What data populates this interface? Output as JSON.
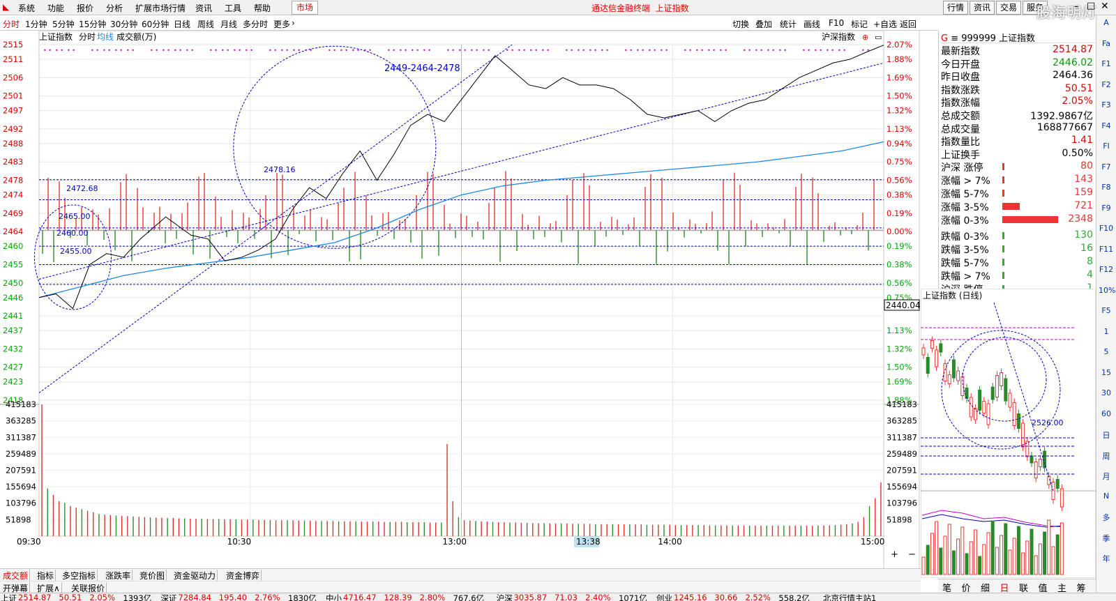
{
  "menu": {
    "items": [
      "系统",
      "功能",
      "报价",
      "分析",
      "扩展市场行情",
      "资讯",
      "工具",
      "帮助"
    ],
    "market_button": "市场",
    "app_title": "通达信金融终端",
    "doc_title": "上证指数",
    "right_buttons": [
      "行情",
      "资讯",
      "交易",
      "服务"
    ],
    "watermark": "股海明灯"
  },
  "periods": {
    "items": [
      "分时",
      "1分钟",
      "5分钟",
      "15分钟",
      "30分钟",
      "60分钟",
      "日线",
      "周线",
      "月线",
      "多分时",
      "更多"
    ],
    "active": "分时",
    "tools": [
      "切换",
      "叠加",
      "统计",
      "画线",
      "F10",
      "标记",
      "+自选",
      "返回"
    ]
  },
  "chart_header": {
    "index_name": "上证指数",
    "tab_label": "分时",
    "avg_label": "均线",
    "indicator_label": "成交额(万)",
    "overlay_label": "沪深指数"
  },
  "chart_data": {
    "type": "line",
    "prev_close": 2464.36,
    "price_ticks": [
      2515,
      2511,
      2506,
      2501,
      2497,
      2492,
      2488,
      2483,
      2478,
      2474,
      2469,
      2464,
      2460,
      2455,
      2450,
      2446,
      2441,
      2437,
      2432,
      2427,
      2423,
      2418
    ],
    "pct_ticks": [
      "2.07%",
      "1.88%",
      "1.69%",
      "1.50%",
      "1.32%",
      "1.13%",
      "0.94%",
      "0.75%",
      "0.56%",
      "0.38%",
      "0.19%",
      "0.00%",
      "0.19%",
      "0.38%",
      "0.56%",
      "0.75%",
      "",
      "1.13%",
      "1.32%",
      "1.50%",
      "1.69%",
      "1.88%"
    ],
    "cursor_price": "2440.04",
    "volume_ticks": [
      "415183",
      "363285",
      "311387",
      "259489",
      "207591",
      "155694",
      "103796",
      "51898"
    ],
    "time_labels": [
      "09:30",
      "10:30",
      "13:00",
      "14:00",
      "15:00"
    ],
    "cursor_time": "13:38",
    "annotations": [
      "2449-2464-2478",
      "2478.16",
      "2472.68",
      "2465.00",
      "2460.00",
      "2455.00"
    ],
    "levels": [
      2478.16,
      2472.68,
      2465.0,
      2460.0,
      2455.0,
      2449.6
    ],
    "price_series": {
      "name": "上证指数",
      "x": [
        0,
        0.02,
        0.04,
        0.06,
        0.08,
        0.1,
        0.12,
        0.15,
        0.18,
        0.2,
        0.22,
        0.24,
        0.26,
        0.28,
        0.3,
        0.32,
        0.34,
        0.36,
        0.38,
        0.4,
        0.42,
        0.44,
        0.46,
        0.48,
        0.5,
        0.52,
        0.54,
        0.56,
        0.58,
        0.6,
        0.62,
        0.64,
        0.66,
        0.68,
        0.7,
        0.72,
        0.74,
        0.76,
        0.78,
        0.8,
        0.82,
        0.84,
        0.86,
        0.88,
        0.9,
        0.92,
        0.94,
        0.96,
        0.98,
        1.0
      ],
      "y": [
        2446,
        2447,
        2443,
        2455,
        2458,
        2457,
        2462,
        2468,
        2463,
        2462,
        2456,
        2457,
        2459,
        2462,
        2470,
        2476,
        2473,
        2480,
        2486,
        2478,
        2485,
        2493,
        2496,
        2494,
        2500,
        2506,
        2512,
        2508,
        2504,
        2503,
        2506,
        2504,
        2504,
        2503,
        2500,
        2496,
        2495,
        2496,
        2497,
        2494,
        2497,
        2499,
        2500,
        2503,
        2506,
        2508,
        2510,
        2511,
        2513,
        2514.87
      ]
    },
    "avg_series": {
      "name": "均线",
      "x": [
        0,
        0.05,
        0.1,
        0.15,
        0.2,
        0.25,
        0.3,
        0.35,
        0.4,
        0.45,
        0.5,
        0.55,
        0.6,
        0.65,
        0.7,
        0.75,
        0.8,
        0.85,
        0.9,
        0.95,
        1.0
      ],
      "y": [
        2446,
        2449,
        2452,
        2454,
        2455.5,
        2457,
        2459,
        2461,
        2465,
        2470,
        2474,
        2476.5,
        2478,
        2479,
        2480,
        2481,
        2482,
        2483,
        2484.5,
        2486,
        2488.5
      ]
    },
    "volume_series": {
      "name": "成交额",
      "values": [
        415183,
        150000,
        130000,
        110000,
        105000,
        95000,
        90000,
        85000,
        80000,
        75000,
        70000,
        68000,
        66000,
        65000,
        64000,
        63000,
        62000,
        61000,
        60000,
        59000,
        58000,
        58000,
        57000,
        57000,
        56000,
        56000,
        55000,
        55000,
        55000,
        54000,
        54000,
        54000,
        53000,
        53000,
        53000,
        52000,
        52000,
        52000,
        51000,
        51000,
        51000,
        50000,
        50000,
        50000,
        50000,
        49000,
        49000,
        49000,
        48000,
        48000,
        48000,
        48000,
        47000,
        47000,
        47000,
        47000,
        46000,
        46000,
        46000,
        46000,
        45000,
        45000,
        45000,
        45000,
        44000,
        44000,
        44000,
        44000,
        43000,
        43000,
        43000,
        290000,
        110000,
        60000,
        50000,
        49000,
        48000,
        47000,
        46000,
        45000,
        44000,
        44000,
        43000,
        43000,
        42000,
        42000,
        41000,
        41000,
        41000,
        40000,
        40000,
        40000,
        40000,
        39000,
        39000,
        39000,
        39000,
        38000,
        38000,
        38000,
        38000,
        37000,
        37000,
        37000,
        37000,
        37000,
        36000,
        36000,
        36000,
        36000,
        36000,
        35000,
        35000,
        35000,
        35000,
        35000,
        35000,
        34000,
        34000,
        34000,
        34000,
        34000,
        34000,
        34000,
        33000,
        33000,
        33000,
        33000,
        33000,
        33000,
        33000,
        33000,
        33000,
        33000,
        33000,
        33000,
        34000,
        34000,
        34000,
        35000,
        36000,
        38000,
        40000,
        45000,
        60000,
        95000,
        120000,
        170000
      ]
    }
  },
  "side_panel": {
    "header_code": "999999",
    "header_name": "上证指数",
    "header_g": "G",
    "quotes": [
      {
        "label": "最新指数",
        "value": "2514.87",
        "color": "#d00"
      },
      {
        "label": "今日开盘",
        "value": "2446.02",
        "color": "#090"
      },
      {
        "label": "昨日收盘",
        "value": "2464.36",
        "color": "#000"
      },
      {
        "label": "指数涨跌",
        "value": "50.51",
        "color": "#d00"
      },
      {
        "label": "指数涨幅",
        "value": "2.05%",
        "color": "#d00"
      },
      {
        "label": "总成交额",
        "value": "1392.9867亿",
        "color": "#000"
      },
      {
        "label": "总成交量",
        "value": "168877667",
        "color": "#000"
      },
      {
        "label": "指数量比",
        "value": "1.41",
        "color": "#d00"
      },
      {
        "label": "上证换手",
        "value": "0.50%",
        "color": "#000"
      }
    ],
    "breadth": [
      {
        "label": "沪深 涨停",
        "value": "80",
        "bar": 0.01,
        "color": "#e33"
      },
      {
        "label": "涨幅 > 7%",
        "value": "143",
        "bar": 0.02,
        "color": "#e33"
      },
      {
        "label": "涨幅 5-7%",
        "value": "159",
        "bar": 0.02,
        "color": "#e33"
      },
      {
        "label": "涨幅 3-5%",
        "value": "721",
        "bar": 0.31,
        "color": "#e33"
      },
      {
        "label": "涨幅 0-3%",
        "value": "2348",
        "bar": 1.0,
        "color": "#e33"
      },
      {
        "label": "跌幅 0-3%",
        "value": "130",
        "bar": 0.02,
        "color": "#3a3"
      },
      {
        "label": "跌幅 3-5%",
        "value": "16",
        "bar": 0.005,
        "color": "#3a3"
      },
      {
        "label": "跌幅 5-7%",
        "value": "8",
        "bar": 0.003,
        "color": "#3a3"
      },
      {
        "label": "跌幅 > 7%",
        "value": "4",
        "bar": 0.002,
        "color": "#3a3"
      },
      {
        "label": "沪深 跌停",
        "value": "1",
        "bar": 0.001,
        "color": "#3a3"
      }
    ],
    "mini_chart_title": "上证指数 (日线)",
    "mini_chart_label": "2526.00"
  },
  "bottom": {
    "tabs1": [
      "成交额",
      "指标",
      "多空指标",
      "涨跌率",
      "竞价图",
      "资金驱动力",
      "资金博弈"
    ],
    "tabs2": [
      "开弹幕",
      "扩展∧",
      "关联报价"
    ],
    "mini_tabs": [
      "笔",
      "价",
      "细",
      "日",
      "联",
      "值",
      "主",
      "筹"
    ],
    "active_mini_tab": "日"
  },
  "tool_column": [
    "A",
    "Fa",
    "F1",
    "F2",
    "F3",
    "F4",
    "FI",
    "F7",
    "F8",
    "F9",
    "F10",
    "F11",
    "F12",
    "10%",
    "F5",
    "1",
    "5",
    "15",
    "30",
    "60",
    "日",
    "周",
    "月",
    "N",
    "多",
    "季",
    "年"
  ],
  "ticker": [
    {
      "name": "上证",
      "value": "2514.87",
      "chg": "50.51",
      "pct": "2.05%",
      "amt": "1393亿"
    },
    {
      "name": "深证",
      "value": "7284.84",
      "chg": "195.40",
      "pct": "2.76%",
      "amt": "1830亿"
    },
    {
      "name": "中小",
      "value": "4716.47",
      "chg": "128.39",
      "pct": "2.80%",
      "amt": "767.6亿"
    },
    {
      "name": "沪深",
      "value": "3035.87",
      "chg": "71.03",
      "pct": "2.40%",
      "amt": "1071亿"
    },
    {
      "name": "创业",
      "value": "1245.16",
      "chg": "30.66",
      "pct": "2.52%",
      "amt": "558.2亿"
    }
  ],
  "status_right": "北京行情主站1",
  "colors": {
    "up": "#e03030",
    "down": "#2e8b2e",
    "avg": "#1e88e5",
    "line": "#000000",
    "dash": "#0000cc"
  }
}
